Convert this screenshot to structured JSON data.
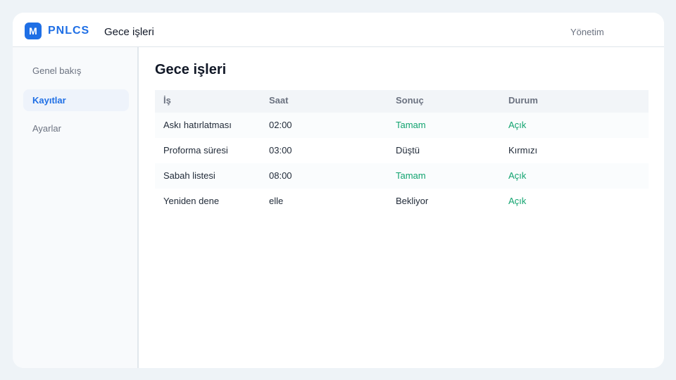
{
  "app": {
    "brand_letter": "M",
    "brand_name": "PNLCS",
    "page_heading": "Gece işleri",
    "top_link": "Yönetim"
  },
  "sidebar": {
    "items": [
      {
        "label": "Genel bakış",
        "active": false
      },
      {
        "label": "Kayıtlar",
        "active": true
      },
      {
        "label": "Ayarlar",
        "active": false
      }
    ]
  },
  "main": {
    "title": "Gece işleri",
    "table": {
      "headers": [
        "İş",
        "Saat",
        "Sonuç",
        "Durum"
      ],
      "rows": [
        {
          "job": "Askı hatırlatması",
          "time": "02:00",
          "result": "Tamam",
          "status": "Açık"
        },
        {
          "job": "Proforma süresi",
          "time": "03:00",
          "result": "Düştü",
          "status": "Kırmızı"
        },
        {
          "job": "Sabah listesi",
          "time": "08:00",
          "result": "Tamam",
          "status": "Açık"
        },
        {
          "job": "Yeniden dene",
          "time": "elle",
          "result": "Bekliyor",
          "status": "Açık"
        }
      ]
    }
  },
  "colors": {
    "brand": "#1f6fe5",
    "success": "#11a36f",
    "page_background": "#eef3f7"
  }
}
